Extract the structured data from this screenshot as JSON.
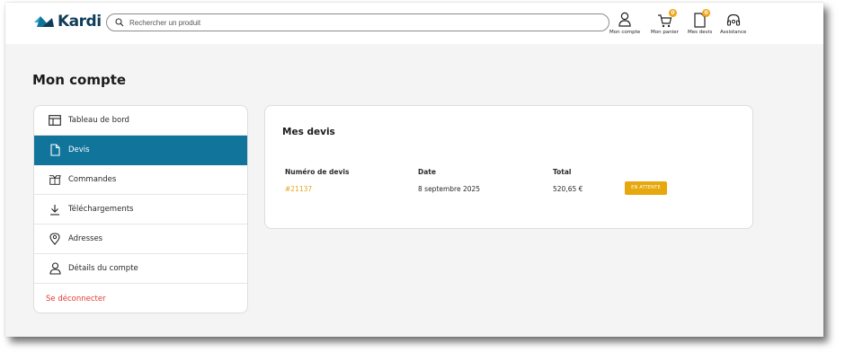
{
  "brand": {
    "name": "Kardi",
    "logo_colors": [
      "#11749b",
      "#0f3c57"
    ]
  },
  "search": {
    "placeholder": "Rechercher un produit",
    "value": ""
  },
  "header_actions": [
    {
      "label": "Mon compte",
      "icon": "user-icon"
    },
    {
      "label": "Mon panier",
      "icon": "cart-icon",
      "badge": "0"
    },
    {
      "label": "Mes devis",
      "icon": "document-icon",
      "badge": "0"
    },
    {
      "label": "Assistance",
      "icon": "headset-icon"
    }
  ],
  "page": {
    "title": "Mon compte"
  },
  "sidebar": {
    "items": [
      {
        "label": "Tableau de bord",
        "icon": "dashboard-icon",
        "active": false
      },
      {
        "label": "Devis",
        "icon": "document-icon",
        "active": true
      },
      {
        "label": "Commandes",
        "icon": "box-icon",
        "active": false
      },
      {
        "label": "Téléchargements",
        "icon": "download-icon",
        "active": false
      },
      {
        "label": "Adresses",
        "icon": "location-pin-icon",
        "active": false
      },
      {
        "label": "Détails du compte",
        "icon": "user-icon",
        "active": false
      }
    ],
    "logout": "Se déconnecter"
  },
  "quotes": {
    "title": "Mes devis",
    "columns": [
      "Numéro de devis",
      "Date",
      "Total"
    ],
    "rows": [
      {
        "number": "#21137",
        "date": "8 septembre 2025",
        "total": "520,65 €",
        "status": "EN ATTENTE"
      }
    ]
  },
  "colors": {
    "accent": "#11749b",
    "badge": "#f2a51a",
    "status": "#e7a80e",
    "link": "#e0a422",
    "logout": "#e53935"
  }
}
